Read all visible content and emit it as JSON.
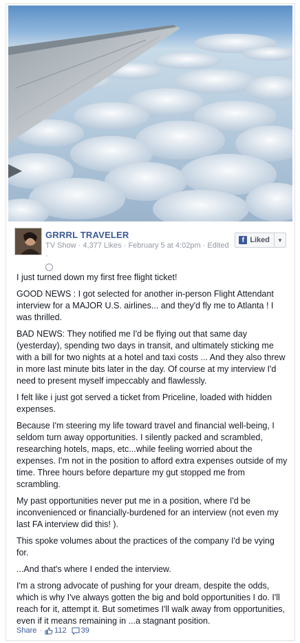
{
  "post": {
    "page_name": "GRRRL TRAVELER",
    "meta": "TV Show · 4,377 Likes · February 5 at 4:02pm · Edited ·",
    "like_button": "Liked",
    "paragraphs": [
      "I just turned down my first free flight ticket!",
      "GOOD NEWS : I got selected for another in-person Flight Attendant interview for a MAJOR U.S. airlines... and they'd fly me to Atlanta ! I was thrilled.",
      "BAD NEWS: They notified me I'd be flying out that same day (yesterday), spending two days in transit, and ultimately sticking me with a bill for two nights at a hotel and taxi costs ... And they also threw in more last minute bits later in the day. Of course at my interview I'd need to present myself impeccably and flawlessly.",
      "I felt like i just got served a ticket from Priceline, loaded with hidden expenses.",
      "Because I'm steering my life toward travel and financial well-being, I seldom turn away opportunities. I silently packed and scrambled, researching hotels, maps, etc...while feeling worried about the expenses. I'm not in the position to afford extra expenses outside of my time. Three hours before departure my gut stopped me from scrambling.",
      "My past opportunities never put me in a position, where I'd be inconvenienced or financially-burdened for an interview (not even my last FA interview did this! ).",
      "This spoke volumes about the practices of the company I'd be vying for.",
      "...And that's where I ended the interview.",
      "I'm a strong advocate of pushing for your dream, despite the odds, which is why I've always gotten the big and bold opportunities I do. I'll reach for it, attempt it. But sometimes I'll walk away from opportunities, even if it means remaining in ...a stagnant position."
    ],
    "footer": {
      "share_label": "Share",
      "separator": "·",
      "likes_count": "112",
      "comments_count": "39"
    }
  },
  "colors": {
    "link_blue": "#3b5998",
    "meta_gray": "#9197a3",
    "text": "#141823"
  }
}
